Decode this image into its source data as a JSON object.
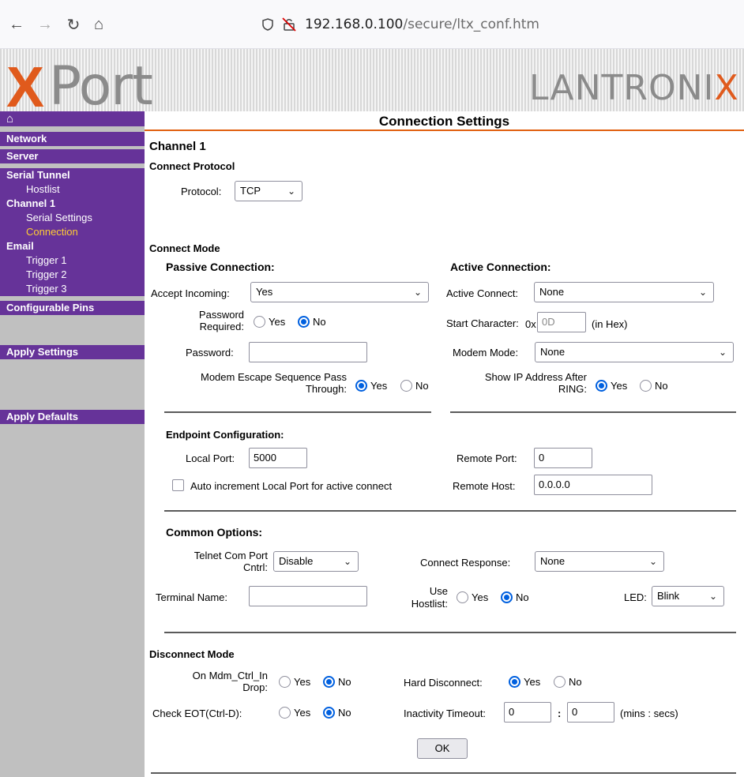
{
  "browser": {
    "url_host": "192.168.0.100",
    "url_path": "/secure/ltx_conf.htm"
  },
  "banner": {
    "product_logo": "XPort",
    "company_logo": "LANTRONIX"
  },
  "sidebar": {
    "home_icon": "home-icon",
    "items": {
      "network": "Network",
      "server": "Server",
      "serial_tunnel": "Serial Tunnel",
      "hostlist": "Hostlist",
      "channel1": "Channel 1",
      "serial_settings": "Serial Settings",
      "connection": "Connection",
      "email": "Email",
      "trigger1": "Trigger 1",
      "trigger2": "Trigger 2",
      "trigger3": "Trigger 3",
      "configurable_pins": "Configurable Pins",
      "apply_settings": "Apply Settings",
      "apply_defaults": "Apply Defaults"
    },
    "active_color": "#ffcc33",
    "bg_color": "#663399"
  },
  "main": {
    "title": "Connection Settings",
    "channel": "Channel 1",
    "connect_protocol": {
      "heading": "Connect Protocol",
      "protocol_label": "Protocol:",
      "protocol_value": "TCP"
    },
    "connect_mode": {
      "heading": "Connect Mode",
      "passive_heading": "Passive Connection:",
      "active_heading": "Active Connection:",
      "accept_incoming_label": "Accept Incoming:",
      "accept_incoming_value": "Yes",
      "password_required_label_1": "Password",
      "password_required_label_2": "Required:",
      "password_required_value": "No",
      "password_label": "Password:",
      "password_value": "",
      "modem_escape_label_1": "Modem Escape Sequence Pass",
      "modem_escape_label_2": "Through:",
      "modem_escape_value": "Yes",
      "active_connect_label": "Active Connect:",
      "active_connect_value": "None",
      "start_char_label": "Start Character:",
      "start_char_prefix": "0x",
      "start_char_placeholder": "0D",
      "start_char_suffix": "(in Hex)",
      "modem_mode_label": "Modem Mode:",
      "modem_mode_value": "None",
      "show_ip_label_1": "Show IP Address After",
      "show_ip_label_2": "RING:",
      "show_ip_value": "Yes"
    },
    "endpoint": {
      "heading": "Endpoint Configuration:",
      "local_port_label": "Local Port:",
      "local_port_value": "5000",
      "remote_port_label": "Remote Port:",
      "remote_port_value": "0",
      "auto_increment_label": "Auto increment Local Port for active connect",
      "auto_increment_checked": false,
      "remote_host_label": "Remote Host:",
      "remote_host_value": "0.0.0.0"
    },
    "common": {
      "heading": "Common Options:",
      "telnet_label_1": "Telnet Com Port",
      "telnet_label_2": "Cntrl:",
      "telnet_value": "Disable",
      "connect_response_label": "Connect Response:",
      "connect_response_value": "None",
      "terminal_name_label": "Terminal Name:",
      "terminal_name_value": "",
      "use_hostlist_label_1": "Use",
      "use_hostlist_label_2": "Hostlist:",
      "use_hostlist_value": "No",
      "led_label": "LED:",
      "led_value": "Blink"
    },
    "disconnect": {
      "heading": "Disconnect Mode",
      "mdm_label_1": "On Mdm_Ctrl_In",
      "mdm_label_2": "Drop:",
      "mdm_value": "No",
      "hard_label": "Hard Disconnect:",
      "hard_value": "Yes",
      "eot_label": "Check EOT(Ctrl-D):",
      "eot_value": "No",
      "inactivity_label": "Inactivity Timeout:",
      "inactivity_mins": "0",
      "inactivity_sep": ":",
      "inactivity_secs": "0",
      "inactivity_units": "(mins : secs)"
    },
    "ok_label": "OK",
    "yes_label": "Yes",
    "no_label": "No",
    "accent_color": "#e06010"
  }
}
